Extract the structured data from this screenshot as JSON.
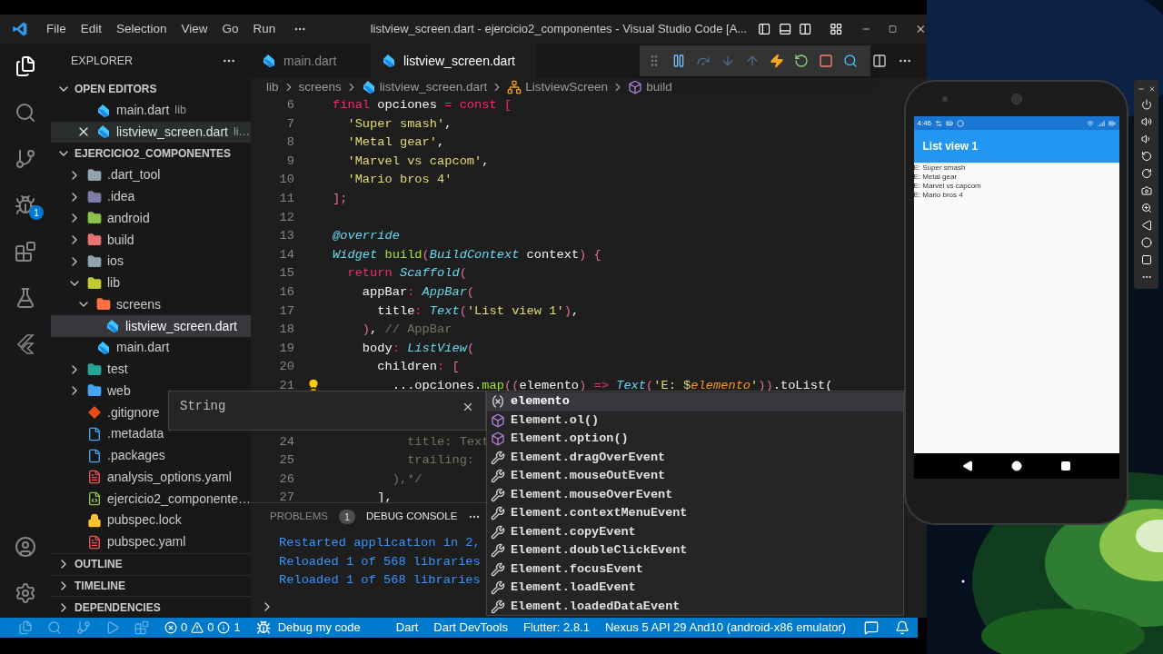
{
  "title_bar": {
    "menu": [
      "File",
      "Edit",
      "Selection",
      "View",
      "Go",
      "Run"
    ],
    "title": "listview_screen.dart - ejercicio2_componentes - Visual Studio Code [A..."
  },
  "activity_bar": {
    "debug_badge": "1"
  },
  "explorer": {
    "title": "EXPLORER",
    "open_editors": {
      "title": "OPEN EDITORS",
      "expanded": true,
      "items": [
        {
          "label": "main.dart",
          "detail": "lib",
          "active": false
        },
        {
          "label": "listview_screen.dart",
          "detail": "li…",
          "active": true
        }
      ]
    },
    "project": {
      "title": "EJERCICIO2_COMPONENTES",
      "expanded": true,
      "items": [
        {
          "label": ".dart_tool",
          "kind": "folder",
          "color": "#90a4ae",
          "expanded": false,
          "selected": false
        },
        {
          "label": ".idea",
          "kind": "folder",
          "color": "#7e7aa8",
          "expanded": false,
          "selected": false
        },
        {
          "label": "android",
          "kind": "folder",
          "color": "#8bc34a",
          "expanded": false,
          "selected": false
        },
        {
          "label": "build",
          "kind": "folder",
          "color": "#e57373",
          "expanded": false,
          "selected": false
        },
        {
          "label": "ios",
          "kind": "folder",
          "color": "#90a4ae",
          "expanded": false,
          "selected": false
        },
        {
          "label": "lib",
          "kind": "folder",
          "color": "#c0ca33",
          "expanded": true,
          "selected": false,
          "children": [
            {
              "label": "screens",
              "kind": "folder",
              "color": "#ff7043",
              "expanded": true,
              "selected": false,
              "children": [
                {
                  "label": "listview_screen.dart",
                  "kind": "dart",
                  "selected": true
                }
              ]
            },
            {
              "label": "main.dart",
              "kind": "dart",
              "selected": false
            }
          ]
        },
        {
          "label": "test",
          "kind": "folder",
          "color": "#26a69a",
          "expanded": false,
          "selected": false
        },
        {
          "label": "web",
          "kind": "folder",
          "color": "#42a5f5",
          "expanded": false,
          "selected": false
        },
        {
          "label": ".gitignore",
          "kind": "git",
          "color": "#e64a19",
          "selected": false
        },
        {
          "label": ".metadata",
          "kind": "doc",
          "color": "#42a5f5",
          "selected": false
        },
        {
          "label": ".packages",
          "kind": "doc",
          "color": "#42a5f5",
          "selected": false
        },
        {
          "label": "analysis_options.yaml",
          "kind": "yaml",
          "color": "#ef5350",
          "selected": false
        },
        {
          "label": "ejercicio2_componente…",
          "kind": "xml",
          "color": "#8bc34a",
          "selected": false
        },
        {
          "label": "pubspec.lock",
          "kind": "lock",
          "color": "#fbc02d",
          "selected": false
        },
        {
          "label": "pubspec.yaml",
          "kind": "yaml",
          "color": "#ef5350",
          "selected": false
        }
      ]
    },
    "sections": [
      {
        "title": "OUTLINE",
        "expanded": false
      },
      {
        "title": "TIMELINE",
        "expanded": false
      },
      {
        "title": "DEPENDENCIES",
        "expanded": false
      }
    ]
  },
  "editor": {
    "tabs": [
      {
        "label": "main.dart",
        "selected": false
      },
      {
        "label": "listview_screen.dart",
        "selected": true
      }
    ],
    "breadcrumb": [
      {
        "label": "lib",
        "kind": "folder"
      },
      {
        "label": "screens",
        "kind": "folder"
      },
      {
        "label": "listview_screen.dart",
        "kind": "dart"
      },
      {
        "label": "ListviewScreen",
        "kind": "class"
      },
      {
        "label": "build",
        "kind": "method"
      }
    ],
    "lines": [
      {
        "number": "6",
        "lightbulb": false,
        "tokens": [
          {
            "t": "final",
            "kind": "kw"
          },
          {
            "t": " opciones",
            "kind": "plain"
          },
          {
            "t": " = const [",
            "kind": "kw"
          }
        ]
      },
      {
        "number": "7",
        "lightbulb": false,
        "tokens": [
          {
            "t": "  'Super smash'",
            "kind": "str"
          },
          {
            "t": ",",
            "kind": "plain"
          }
        ]
      },
      {
        "number": "8",
        "lightbulb": false,
        "tokens": [
          {
            "t": "  'Metal gear'",
            "kind": "str"
          },
          {
            "t": ",",
            "kind": "plain"
          }
        ]
      },
      {
        "number": "9",
        "lightbulb": false,
        "tokens": [
          {
            "t": "  'Marvel vs capcom'",
            "kind": "str"
          },
          {
            "t": ",",
            "kind": "plain"
          }
        ]
      },
      {
        "number": "10",
        "lightbulb": false,
        "tokens": [
          {
            "t": "  'Mario bros 4'",
            "kind": "str"
          }
        ]
      },
      {
        "number": "11",
        "lightbulb": false,
        "tokens": [
          {
            "t": "];",
            "kind": "br"
          }
        ]
      },
      {
        "number": "12",
        "lightbulb": false
      },
      {
        "number": "13",
        "lightbulb": false,
        "tokens": [
          {
            "t": "@override",
            "kind": "type"
          }
        ]
      },
      {
        "number": "14",
        "lightbulb": false,
        "tokens": [
          {
            "t": "Widget",
            "kind": "type"
          },
          {
            "t": " build",
            "kind": "fn"
          },
          {
            "t": "(",
            "kind": "br"
          },
          {
            "t": "BuildContext",
            "kind": "type"
          },
          {
            "t": " context",
            "kind": "plain"
          },
          {
            "t": ") {",
            "kind": "br"
          }
        ]
      },
      {
        "number": "15",
        "lightbulb": false,
        "tokens": [
          {
            "t": "  return",
            "kind": "kw"
          },
          {
            "t": " Scaffold",
            "kind": "type"
          },
          {
            "t": "(",
            "kind": "br"
          }
        ]
      },
      {
        "number": "16",
        "lightbulb": false,
        "tokens": [
          {
            "t": "    appBar",
            "kind": "plain"
          },
          {
            "t": ":",
            "kind": "kw"
          },
          {
            "t": " AppBar",
            "kind": "type"
          },
          {
            "t": "(",
            "kind": "br"
          }
        ]
      },
      {
        "number": "17",
        "lightbulb": false,
        "tokens": [
          {
            "t": "      title",
            "kind": "plain"
          },
          {
            "t": ":",
            "kind": "kw"
          },
          {
            "t": " Text",
            "kind": "type"
          },
          {
            "t": "(",
            "kind": "br"
          },
          {
            "t": "'List view 1'",
            "kind": "str"
          },
          {
            "t": ")",
            "kind": "br"
          },
          {
            "t": ",",
            "kind": "plain"
          }
        ]
      },
      {
        "number": "18",
        "lightbulb": false,
        "tokens": [
          {
            "t": "    )",
            "kind": "br"
          },
          {
            "t": ",",
            "kind": "plain"
          },
          {
            "t": " // AppBar",
            "kind": "com"
          }
        ]
      },
      {
        "number": "19",
        "lightbulb": false,
        "tokens": [
          {
            "t": "    body",
            "kind": "plain"
          },
          {
            "t": ":",
            "kind": "kw"
          },
          {
            "t": " ListView",
            "kind": "type"
          },
          {
            "t": "(",
            "kind": "br"
          }
        ]
      },
      {
        "number": "20",
        "lightbulb": false,
        "tokens": [
          {
            "t": "      children",
            "kind": "plain"
          },
          {
            "t": ":",
            "kind": "kw"
          },
          {
            "t": " [",
            "kind": "br"
          }
        ]
      },
      {
        "number": "21",
        "lightbulb": true,
        "tokens": [
          {
            "t": "        ...opciones.",
            "kind": "plain"
          },
          {
            "t": "map",
            "kind": "fn"
          },
          {
            "t": "((",
            "kind": "br"
          },
          {
            "t": "elemento",
            "kind": "plain"
          },
          {
            "t": ")",
            "kind": "br"
          },
          {
            "t": " =>",
            "kind": "kw"
          },
          {
            "t": " Text",
            "kind": "type"
          },
          {
            "t": "(",
            "kind": "br"
          },
          {
            "t": "'E: $",
            "kind": "str"
          },
          {
            "t": "elemento",
            "kind": "var"
          },
          {
            "t": "'",
            "kind": "str"
          },
          {
            "t": "))",
            "kind": "br"
          },
          {
            "t": ".toList(",
            "kind": "plain"
          }
        ]
      },
      {
        "number": "24",
        "lightbulb": false,
        "tokens": [
          {
            "t": "          title: Text",
            "kind": "com"
          }
        ]
      },
      {
        "number": "25",
        "lightbulb": false,
        "tokens": [
          {
            "t": "          trailing:",
            "kind": "com"
          }
        ]
      },
      {
        "number": "26",
        "lightbulb": false,
        "tokens": [
          {
            "t": "        ),*/",
            "kind": "com"
          }
        ]
      },
      {
        "number": "27",
        "lightbulb": false,
        "tokens": [
          {
            "t": "      ],",
            "kind": "plain"
          }
        ]
      }
    ],
    "detail_popup": {
      "text": "String"
    },
    "suggestions": [
      {
        "label": "elemento",
        "kind": "variable",
        "selected": true
      },
      {
        "label": "Element.ol()",
        "kind": "method",
        "selected": false
      },
      {
        "label": "Element.option()",
        "kind": "method",
        "selected": false
      },
      {
        "label": "Element.dragOverEvent",
        "kind": "property",
        "selected": false
      },
      {
        "label": "Element.mouseOutEvent",
        "kind": "property",
        "selected": false
      },
      {
        "label": "Element.mouseOverEvent",
        "kind": "property",
        "selected": false
      },
      {
        "label": "Element.contextMenuEvent",
        "kind": "property",
        "selected": false
      },
      {
        "label": "Element.copyEvent",
        "kind": "property",
        "selected": false
      },
      {
        "label": "Element.doubleClickEvent",
        "kind": "property",
        "selected": false
      },
      {
        "label": "Element.focusEvent",
        "kind": "property",
        "selected": false
      },
      {
        "label": "Element.loadEvent",
        "kind": "property",
        "selected": false
      },
      {
        "label": "Element.loadedDataEvent",
        "kind": "property",
        "selected": false
      }
    ]
  },
  "panel": {
    "tabs": [
      {
        "label": "PROBLEMS",
        "badge": "1",
        "selected": false
      },
      {
        "label": "DEBUG CONSOLE",
        "selected": true
      }
    ],
    "console": [
      "Restarted application in 2,",
      "Reloaded 1 of 568 libraries",
      "Reloaded 1 of 568 libraries"
    ]
  },
  "status_bar": {
    "problems": {
      "errors": "0",
      "warnings": "0",
      "infos": "1"
    },
    "items": [
      {
        "label": "Debug my code",
        "kind": "debug"
      },
      {
        "label": "Dart",
        "kind": "text"
      },
      {
        "label": "Dart DevTools",
        "kind": "text"
      },
      {
        "label": "Flutter: 2.8.1",
        "kind": "text"
      },
      {
        "label": "Nexus 5 API 29 And10 (android-x86 emulator)",
        "kind": "text"
      }
    ]
  },
  "phone": {
    "time": "4:46",
    "app_title": "List view 1",
    "items": [
      "E: Super smash",
      "E: Metal gear",
      "E: Marvel vs capcom",
      "E: Mario bros 4"
    ]
  }
}
